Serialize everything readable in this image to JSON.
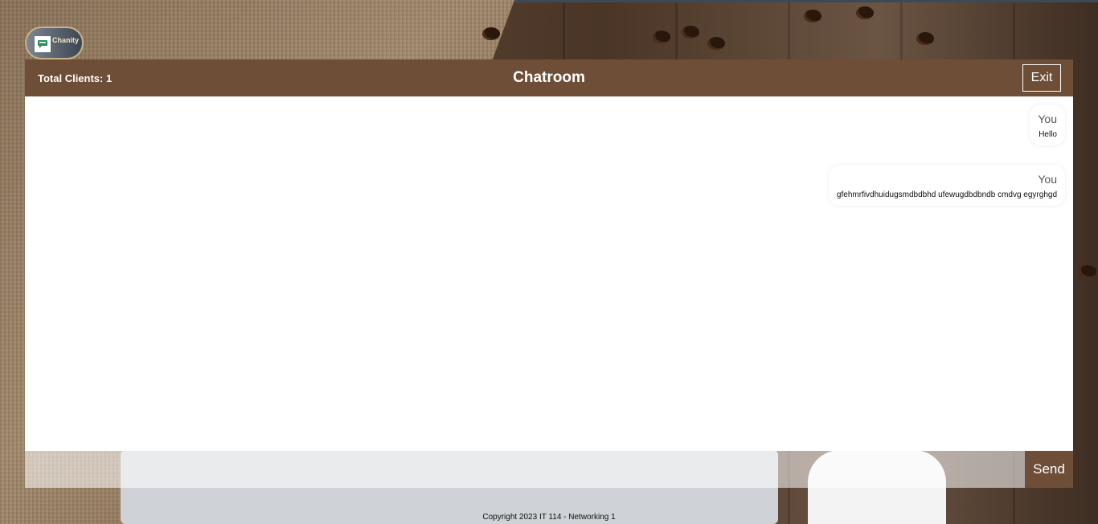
{
  "brand": {
    "name": "Chanity",
    "logo_icon": "chat-logo-icon"
  },
  "header": {
    "clients_label": "Total Clients: 1",
    "title": "Chatroom",
    "exit_label": "Exit"
  },
  "messages": [
    {
      "sender": "You",
      "text": "Hello"
    },
    {
      "sender": "You",
      "text": "gfehmrfivdhuidugsmdbdbhd ufewugdbdbndb cmdvg egyrghgd"
    }
  ],
  "composer": {
    "input_value": "",
    "send_label": "Send"
  },
  "footer": {
    "copyright": "Copyright 2023 IT 114 - Networking 1"
  },
  "colors": {
    "accent": "#6e4e37",
    "header_text": "#ffffff"
  }
}
